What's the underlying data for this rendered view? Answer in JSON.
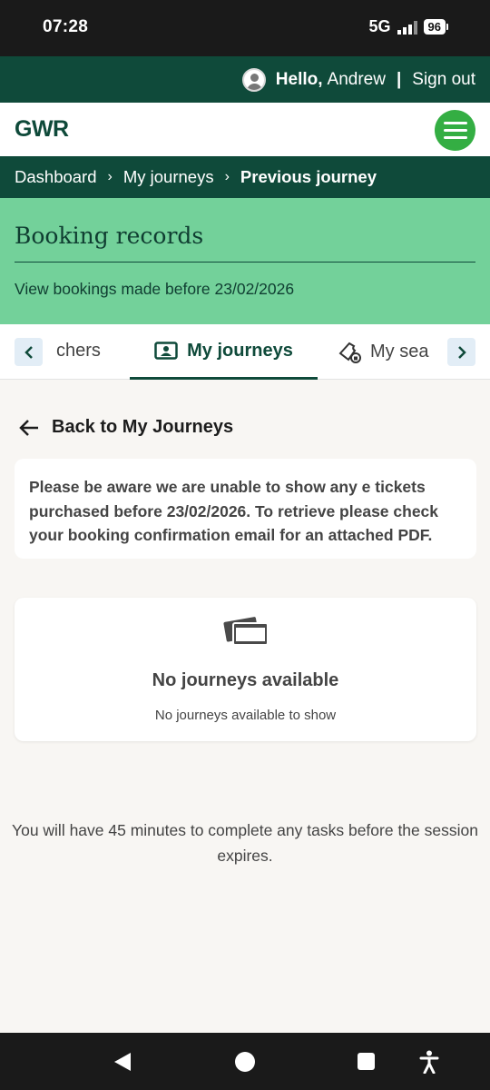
{
  "status_bar": {
    "time": "07:28",
    "network": "5G",
    "battery": "96"
  },
  "user_bar": {
    "hello": "Hello,",
    "name": "Andrew",
    "separator": "|",
    "sign_out": "Sign out"
  },
  "logo": {
    "text": "GWR"
  },
  "breadcrumb": {
    "items": [
      "Dashboard",
      "My journeys"
    ],
    "current": "Previous journey",
    "separator": "›"
  },
  "hero": {
    "title": "Booking records",
    "subtitle": "View bookings made before 23/02/2026"
  },
  "tabs": {
    "left_partial": "chers",
    "active": "My journeys",
    "right_partial": "My sea"
  },
  "back_link": {
    "label": "Back to My Journeys"
  },
  "notice": {
    "text": "Please be aware we are unable to show any e tickets purchased before 23/02/2026. To retrieve please check your booking confirmation email for an attached PDF."
  },
  "empty_state": {
    "title": "No journeys available",
    "subtitle": "No journeys available to show"
  },
  "session": {
    "text": "You will have 45 minutes to complete any tasks before the session expires."
  },
  "colors": {
    "brand_dark": "#0f4a3a",
    "brand_green": "#34ae43",
    "hero_green": "#73d19a",
    "page_bg": "#f8f6f3"
  }
}
